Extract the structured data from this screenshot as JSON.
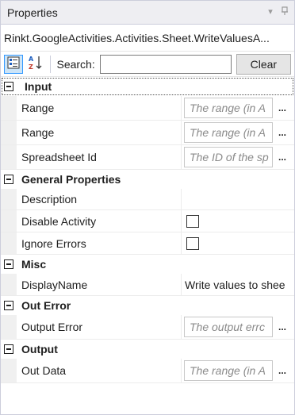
{
  "panel": {
    "title": "Properties",
    "object_name": "Rinkt.GoogleActivities.Activities.Sheet.WriteValuesA..."
  },
  "toolbar": {
    "categorized_icon": "categorized-view-icon",
    "alphabetical_icon": "alphabetical-sort-icon",
    "search_label": "Search:",
    "search_value": "",
    "clear_label": "Clear"
  },
  "categories": {
    "input": {
      "label": "Input",
      "rows": [
        {
          "name": "Range",
          "placeholder": "The range (in A"
        },
        {
          "name": "Range",
          "placeholder": "The range (in A"
        },
        {
          "name": "Spreadsheet Id",
          "placeholder": "The ID of the sp"
        }
      ]
    },
    "general": {
      "label": "General Properties",
      "description": "Description",
      "disable_activity": "Disable Activity",
      "ignore_errors": "Ignore Errors"
    },
    "misc": {
      "label": "Misc",
      "display_name": "DisplayName",
      "display_value": "Write values to shee"
    },
    "out_error": {
      "label": "Out Error",
      "output_error": "Output Error",
      "output_error_placeholder": "The output errc"
    },
    "output": {
      "label": "Output",
      "out_data": "Out Data",
      "out_data_placeholder": "The range (in A"
    }
  },
  "ellipsis": "...",
  "colors": {
    "titlebar": "#eeeef2",
    "selected_toolbar_button": "#cce4f7",
    "placeholder_text": "#8a8a8a"
  }
}
